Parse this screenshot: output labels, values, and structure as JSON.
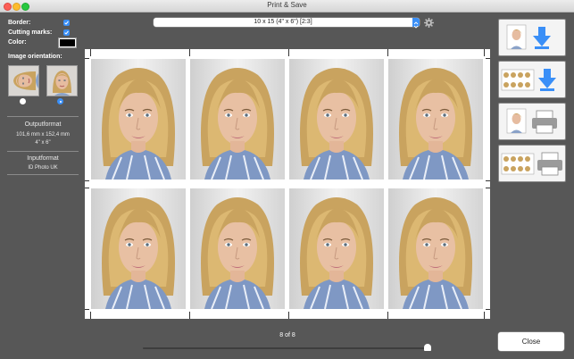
{
  "window": {
    "title": "Print & Save"
  },
  "options": {
    "border_label": "Border:",
    "border_checked": true,
    "cutting_marks_label": "Cutting marks:",
    "cutting_marks_checked": true,
    "color_label": "Color:",
    "color_value": "#000000"
  },
  "orientation": {
    "label": "Image orientation:",
    "selected": "portrait"
  },
  "output": {
    "heading": "Outputformat",
    "size_mm": "101,6 mm x 152,4 mm",
    "size_in": "4\" x 6\""
  },
  "input": {
    "heading": "Inputformat",
    "value": "ID Photo UK"
  },
  "format_select": {
    "value": "10 x 15 (4\" x 6\") [2:3]"
  },
  "preview": {
    "rows": 2,
    "cols": 4,
    "photo_count": 8
  },
  "pagination": {
    "text": "8 of 8",
    "fraction": 1.0
  },
  "actions": {
    "save_single": "save-single-icon",
    "save_sheet": "save-sheet-icon",
    "print_single": "print-single-icon",
    "print_sheet": "print-sheet-icon"
  },
  "close_label": "Close"
}
